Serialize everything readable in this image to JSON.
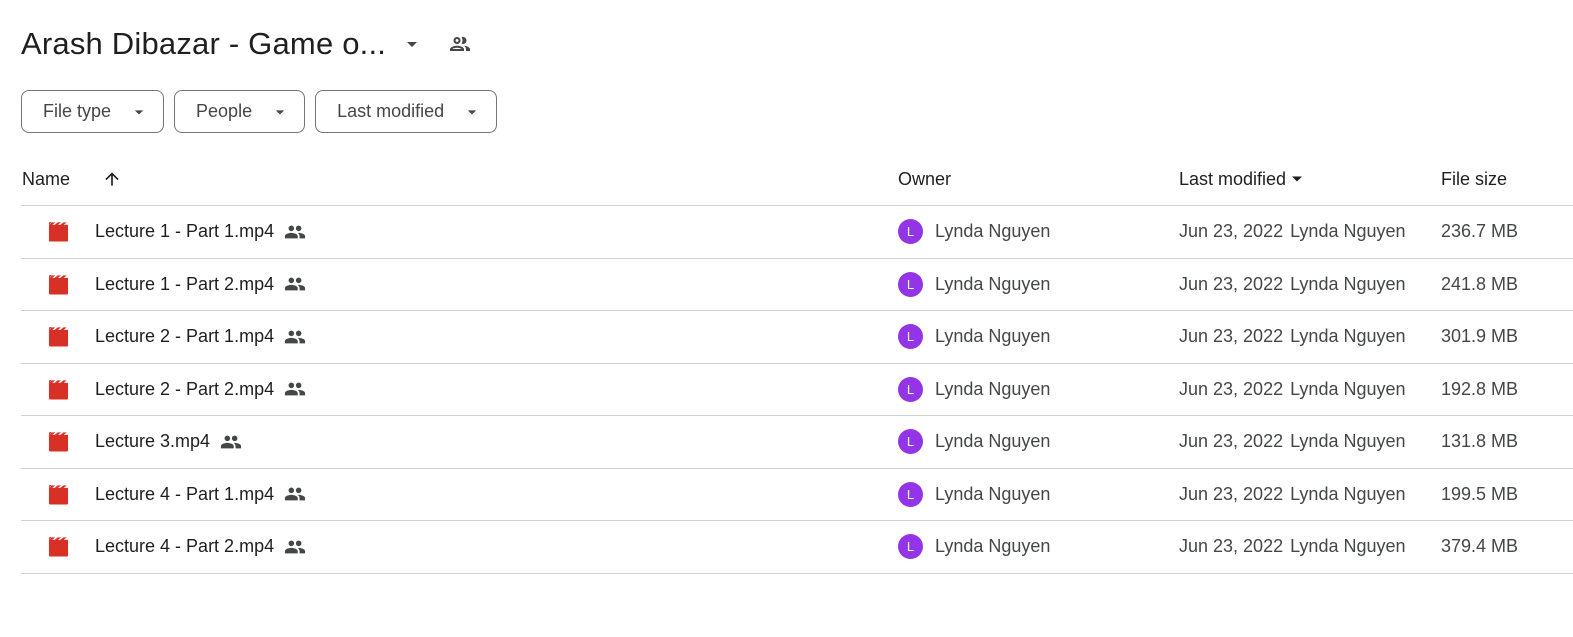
{
  "header": {
    "folder_title": "Arash Dibazar - Game o...",
    "title_caret_icon": "arrow-drop-down-icon",
    "shared_icon": "people-outline-icon"
  },
  "filters": [
    {
      "label": "File type"
    },
    {
      "label": "People"
    },
    {
      "label": "Last modified"
    }
  ],
  "table": {
    "columns": {
      "name": "Name",
      "owner": "Owner",
      "last_modified": "Last modified",
      "file_size": "File size"
    },
    "name_sort_icon": "arrow-upward-icon",
    "modified_sort_icon": "arrow-drop-down-icon",
    "rows": [
      {
        "name": "Lecture 1 - Part 1.mp4",
        "owner": "Lynda Nguyen",
        "owner_initial": "L",
        "modified_date": "Jun 23, 2022",
        "modified_by": "Lynda Nguyen",
        "size": "236.7 MB"
      },
      {
        "name": "Lecture 1 - Part 2.mp4",
        "owner": "Lynda Nguyen",
        "owner_initial": "L",
        "modified_date": "Jun 23, 2022",
        "modified_by": "Lynda Nguyen",
        "size": "241.8 MB"
      },
      {
        "name": "Lecture 2 - Part 1.mp4",
        "owner": "Lynda Nguyen",
        "owner_initial": "L",
        "modified_date": "Jun 23, 2022",
        "modified_by": "Lynda Nguyen",
        "size": "301.9 MB"
      },
      {
        "name": "Lecture 2 - Part 2.mp4",
        "owner": "Lynda Nguyen",
        "owner_initial": "L",
        "modified_date": "Jun 23, 2022",
        "modified_by": "Lynda Nguyen",
        "size": "192.8 MB"
      },
      {
        "name": "Lecture 3.mp4",
        "owner": "Lynda Nguyen",
        "owner_initial": "L",
        "modified_date": "Jun 23, 2022",
        "modified_by": "Lynda Nguyen",
        "size": "131.8 MB"
      },
      {
        "name": "Lecture 4 - Part 1.mp4",
        "owner": "Lynda Nguyen",
        "owner_initial": "L",
        "modified_date": "Jun 23, 2022",
        "modified_by": "Lynda Nguyen",
        "size": "199.5 MB"
      },
      {
        "name": "Lecture 4 - Part 2.mp4",
        "owner": "Lynda Nguyen",
        "owner_initial": "L",
        "modified_date": "Jun 23, 2022",
        "modified_by": "Lynda Nguyen",
        "size": "379.4 MB"
      }
    ]
  },
  "colors": {
    "video_icon": "#d93025",
    "avatar_bg": "#9334e6",
    "border": "#d0d0d0",
    "chip_border": "#747775"
  }
}
